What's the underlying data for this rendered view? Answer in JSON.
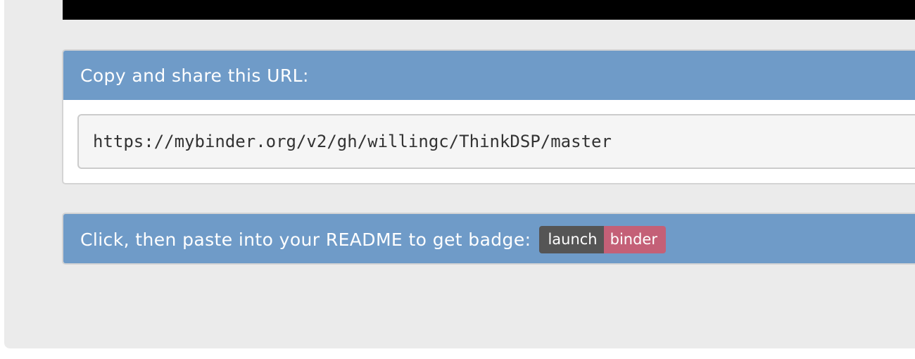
{
  "share": {
    "header_label": "Copy and share this URL:",
    "url_value": "https://mybinder.org/v2/gh/willingc/ThinkDSP/master"
  },
  "badge_section": {
    "header_label": "Click, then paste into your README to get badge:",
    "badge": {
      "left_text": "launch",
      "right_text": "binder",
      "left_color": "#555555",
      "right_color": "#c46077"
    }
  },
  "colors": {
    "header_bg": "#6f9bc8",
    "panel_bg": "#ebebeb"
  }
}
